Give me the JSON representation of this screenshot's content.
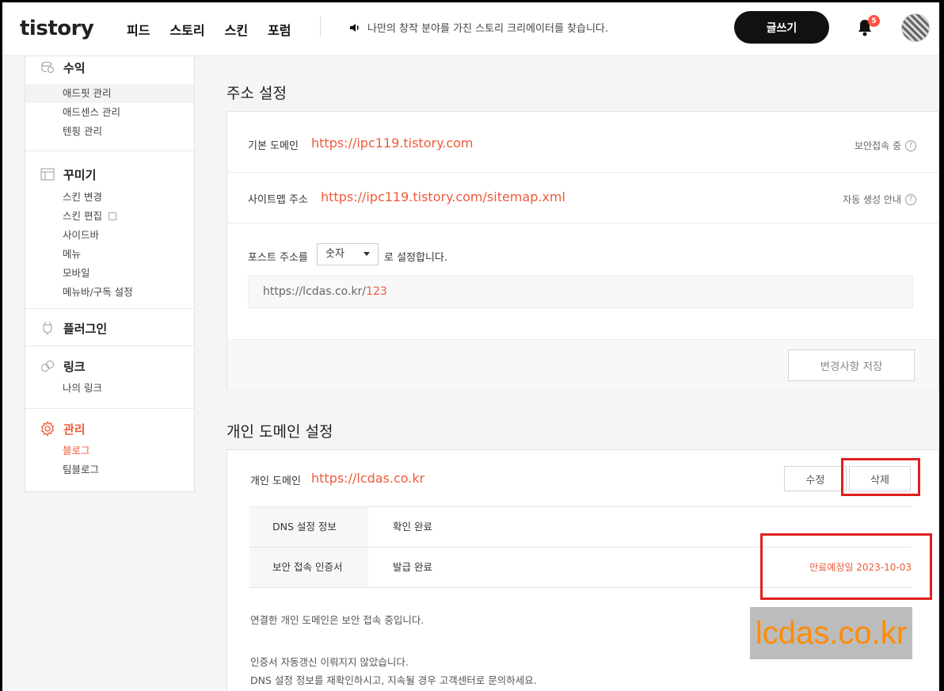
{
  "header": {
    "logo": "tistory",
    "nav": [
      "피드",
      "스토리",
      "스킨",
      "포럼"
    ],
    "notice": "나만의 창작 분야를 가진 스토리 크리에이터를 찾습니다.",
    "write_button": "글쓰기",
    "notification_count": "5"
  },
  "sidebar": {
    "groups": [
      {
        "title": "수익",
        "icon": "coins-icon",
        "items": [
          "애드핏 관리",
          "애드센스 관리",
          "텐핑 관리"
        ]
      },
      {
        "title": "꾸미기",
        "icon": "layout-icon",
        "items": [
          "스킨 변경",
          "스킨 편집",
          "사이드바",
          "메뉴",
          "모바일",
          "메뉴바/구독 설정"
        ]
      },
      {
        "title": "플러그인",
        "icon": "plug-icon",
        "items": []
      },
      {
        "title": "링크",
        "icon": "link-icon",
        "items": [
          "나의 링크"
        ]
      },
      {
        "title": "관리",
        "icon": "gear-icon",
        "items": [
          "블로그",
          "팀블로그"
        ]
      }
    ]
  },
  "address": {
    "title": "주소 설정",
    "default_domain_label": "기본 도메인",
    "default_domain": "https://ipc119.tistory.com",
    "secure_label": "보안접속 중",
    "sitemap_label": "사이트맵 주소",
    "sitemap_url": "https://ipc119.tistory.com/sitemap.xml",
    "sitemap_aux": "자동 생성 안내",
    "post_label": "포스트 주소를",
    "post_select": "숫자",
    "post_suffix": "로 설정합니다.",
    "preview_base": "https://lcdas.co.kr/",
    "preview_num": "123",
    "save_button": "변경사항 저장"
  },
  "custom_domain": {
    "title": "개인 도메인 설정",
    "label": "개인 도메인",
    "domain": "https://lcdas.co.kr",
    "edit_button": "수정",
    "delete_button": "삭제",
    "rows": [
      {
        "key": "DNS 설정 정보",
        "value": "확인 완료",
        "extra": ""
      },
      {
        "key": "보안 접속 인증서",
        "value": "발급 완료",
        "extra": "만료예정일 2023-10-03"
      }
    ],
    "note1": "연결한 개인 도메인은 보안 접속 중입니다.",
    "note2": "인증서 자동갱신 이뤄지지 않았습니다.",
    "note3": "DNS 설정 정보를 재확인하시고, 지속될 경우 고객센터로 문의하세요."
  },
  "watermark": "lcdas.co.kr",
  "colors": {
    "accent": "#ef5a3b",
    "highlight": "#e02020",
    "watermark": "#ff8c00"
  }
}
